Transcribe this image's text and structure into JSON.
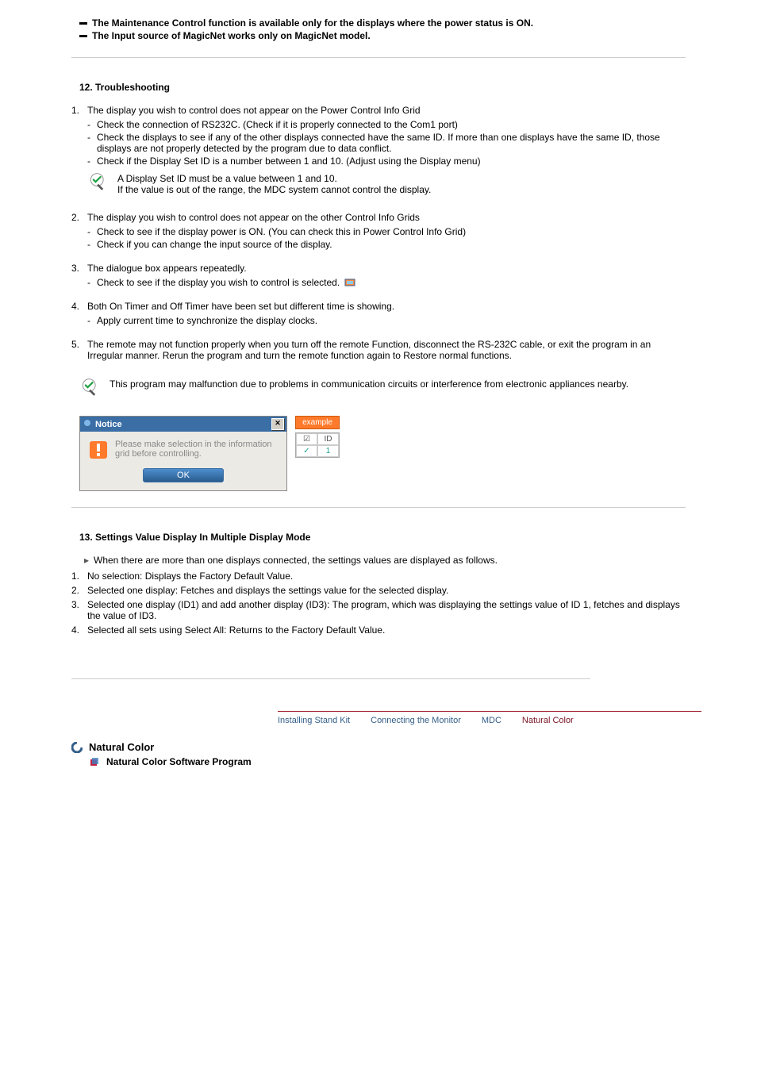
{
  "top_notes": [
    "The Maintenance Control function is available only for the displays where the power status is ON.",
    "The Input source of MagicNet works only on MagicNet model."
  ],
  "section12": {
    "title": "12. Troubleshooting",
    "items": [
      {
        "num": "1.",
        "text": "The display you wish to control does not appear on the Power Control Info Grid",
        "subs": [
          "Check the connection of RS232C. (Check if it is properly connected to the Com1 port)",
          "Check the displays to see if any of the other displays connected have the same ID. If more than one displays have the same ID, those displays are not properly detected by the program due to data conflict.",
          "Check if the Display Set ID is a number between 1 and 10. (Adjust using the Display menu)"
        ],
        "note": "A Display Set ID must be a value between 1 and 10.\nIf the value is out of the range, the MDC system cannot control the display."
      },
      {
        "num": "2.",
        "text": "The display you wish to control does not appear on the other Control Info Grids",
        "subs": [
          "Check to see if the display power is ON. (You can check this in Power Control Info Grid)",
          "Check if you can change the input source of the display."
        ]
      },
      {
        "num": "3.",
        "text": "The dialogue box appears repeatedly.",
        "subs": [
          "Check to see if the display you wish to control is selected."
        ],
        "inline_icon": true
      },
      {
        "num": "4.",
        "text": "Both On Timer and Off Timer have been set but different time is showing.",
        "subs": [
          "Apply current time to synchronize the display clocks."
        ]
      },
      {
        "num": "5.",
        "text": "The remote may not function properly when you turn off the remote Function, disconnect the RS-232C cable, or exit the program in an Irregular manner. Rerun the program and turn the remote function again to Restore normal functions."
      }
    ],
    "standalone_note": "This program may malfunction due to problems in communication circuits or interference from electronic appliances nearby."
  },
  "dialog": {
    "title": "Notice",
    "message": "Please make selection in the information grid before controlling.",
    "ok": "OK",
    "example_label": "example",
    "table_header": [
      "☑",
      "ID"
    ],
    "table_row": [
      "✓",
      "1"
    ]
  },
  "section13": {
    "title": "13. Settings Value Display In Multiple Display Mode",
    "arrow_text": "When there are more than one displays connected, the settings values are displayed as follows.",
    "items": [
      {
        "num": "1.",
        "text": "No selection: Displays the Factory Default Value."
      },
      {
        "num": "2.",
        "text": "Selected one display: Fetches and displays the settings value for the selected display."
      },
      {
        "num": "3.",
        "text": "Selected one display (ID1) and add another display (ID3): The program, which was displaying the settings value of ID 1, fetches and displays the value of ID3."
      },
      {
        "num": "4.",
        "text": "Selected all sets using Select All: Returns to the Factory Default Value."
      }
    ]
  },
  "tabs": {
    "installing": "Installing Stand Kit",
    "connecting": "Connecting the Monitor",
    "mdc": "MDC",
    "natural": "Natural Color"
  },
  "natural_color": {
    "heading": "Natural Color",
    "sub": "Natural Color Software Program"
  }
}
